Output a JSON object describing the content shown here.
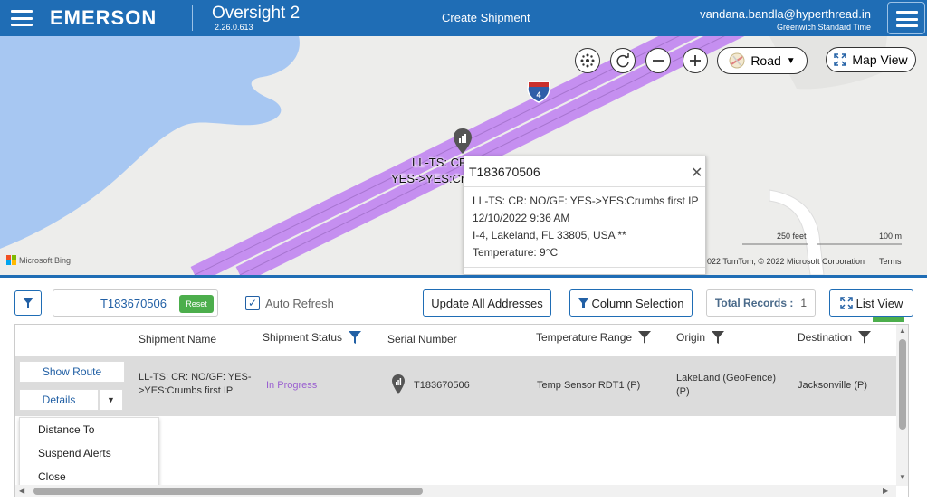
{
  "header": {
    "brand": "EMERSON",
    "app_name": "Oversight 2",
    "version": "2.26.0.613",
    "page_title": "Create Shipment",
    "user_email": "vandana.bandla@hyperthread.in",
    "timezone": "Greenwich Standard Time"
  },
  "map": {
    "road_label": "Road",
    "map_view_label": "Map View",
    "highway_number": "4",
    "marker_label_line1": "LL-TS: CR",
    "marker_label_line2": "YES->YES:Cr",
    "popup": {
      "title": "T183670506",
      "line1": "LL-TS: CR: NO/GF: YES->YES:Crumbs first IP",
      "line2": "12/10/2022 9:36 AM",
      "line3": "I-4, Lakeland, FL 33805, USA **",
      "line4": "Temperature: 9°C"
    },
    "scale_feet": "250 feet",
    "scale_m": "100 m",
    "provider": "Microsoft Bing",
    "attribution": "022 TomTom, © 2022 Microsoft Corporation",
    "terms": "Terms"
  },
  "toolbar": {
    "search_value": "T183670506",
    "reset_label": "Reset",
    "auto_refresh_label": "Auto Refresh",
    "auto_refresh_checked": true,
    "update_addresses_label": "Update All Addresses",
    "column_selection_label": "Column Selection",
    "total_records_label": "Total Records :",
    "total_records_value": "1",
    "list_view_label": "List View"
  },
  "grid": {
    "columns": [
      "Shipment Name",
      "Shipment Status",
      "Serial Number",
      "Temperature Range",
      "Origin",
      "Destination"
    ],
    "row": {
      "show_route": "Show Route",
      "details": "Details",
      "shipment_name_line1": "LL-TS: CR: NO/GF: YES-",
      "shipment_name_line2": ">YES:Crumbs first IP",
      "shipment_status": "In Progress",
      "serial_number": "T183670506",
      "temperature_range": "Temp Sensor RDT1 (P)",
      "origin_line1": "LakeLand (GeoFence)",
      "origin_line2": "(P)",
      "destination": "Jacksonville (P)"
    },
    "dropdown": [
      "Distance To",
      "Suspend Alerts",
      "Close"
    ]
  },
  "colors": {
    "primary": "#1f6db5",
    "highway": "#c58ff0",
    "water": "#a7c7f2",
    "status_in_progress": "#9a5fd0",
    "reset_green": "#4cae4c"
  }
}
